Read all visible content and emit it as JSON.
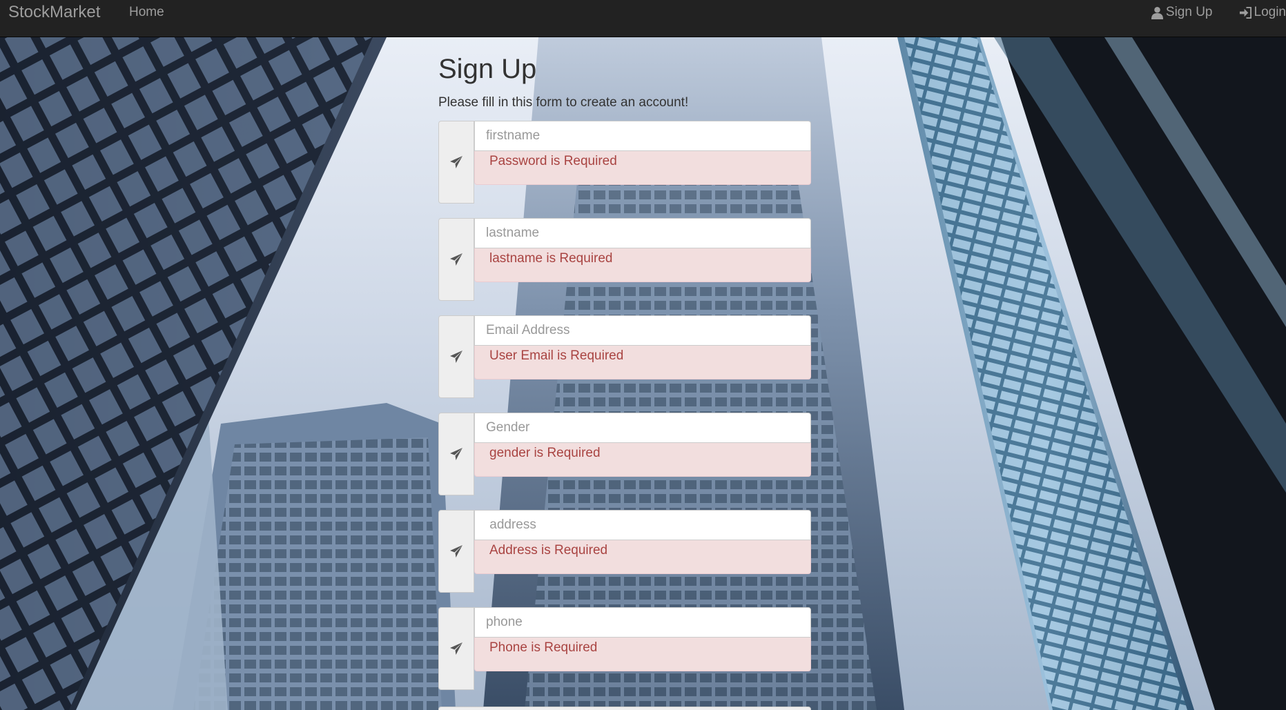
{
  "navbar": {
    "brand": "StockMarket",
    "home": "Home",
    "signup": "Sign Up",
    "login": "Login"
  },
  "form": {
    "title": "Sign Up",
    "subtitle": "Please fill in this form to create an account!",
    "fields": [
      {
        "placeholder": "firstname",
        "error": "Password is Required"
      },
      {
        "placeholder": "lastname",
        "error": "lastname is Required"
      },
      {
        "placeholder": "Email Address",
        "error": "User Email is Required"
      },
      {
        "placeholder": "Gender",
        "error": "gender is Required"
      },
      {
        "placeholder": " address",
        "error": "Address is Required"
      },
      {
        "placeholder": "phone",
        "error": "Phone is Required"
      }
    ]
  },
  "icons": {
    "brand_field": "paper-plane-icon",
    "signup": "user-icon",
    "login": "log-in-icon"
  },
  "colors": {
    "navbar_bg": "#222222",
    "nav_text": "#9d9d9d",
    "error_bg": "#f2dede",
    "error_text": "#a94442",
    "addon_bg": "#eeeeee"
  }
}
